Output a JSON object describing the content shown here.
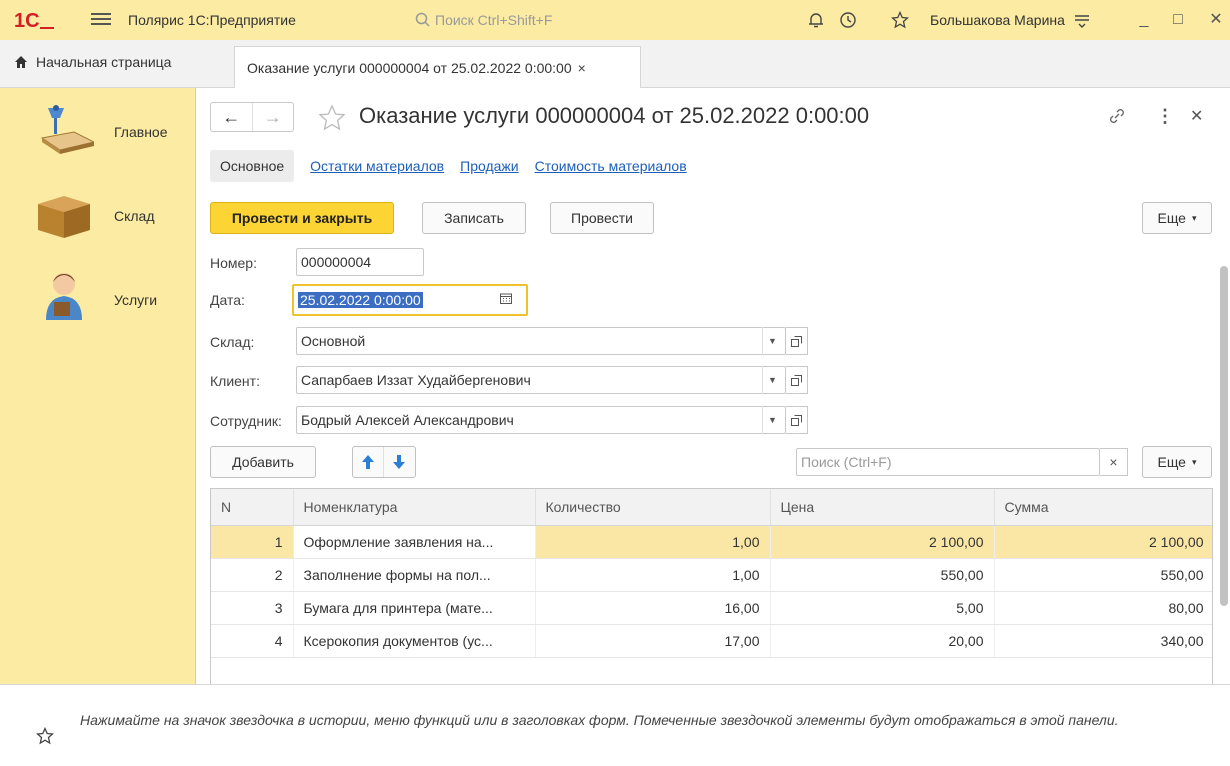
{
  "app": {
    "logo_text": "1С",
    "title": "Полярис 1С:Предприятие",
    "search_placeholder": "Поиск Ctrl+Shift+F",
    "user": "Большакова Марина",
    "brand_color": "#fbeba3"
  },
  "tabs": {
    "home": "Начальная страница",
    "active": "Оказание услуги 000000004 от 25.02.2022 0:00:00",
    "active_close": "×"
  },
  "sidebar": {
    "items": [
      {
        "label": "Главное",
        "icon": "desk-lamp-icon"
      },
      {
        "label": "Склад",
        "icon": "box-icon"
      },
      {
        "label": "Услуги",
        "icon": "operator-icon"
      }
    ]
  },
  "form": {
    "title": "Оказание услуги 000000004 от 25.02.2022 0:00:00",
    "subtabs": [
      "Основное",
      "Остатки материалов",
      "Продажи",
      "Стоимость материалов"
    ],
    "buttons": {
      "post_close": "Провести и закрыть",
      "save": "Записать",
      "post": "Провести",
      "more": "Еще"
    },
    "fields": {
      "number_label": "Номер:",
      "number_value": "000000004",
      "date_label": "Дата:",
      "date_value": "25.02.2022  0:00:00",
      "warehouse_label": "Склад:",
      "warehouse_value": "Основной",
      "client_label": "Клиент:",
      "client_value": "Сапарбаев Иззат Худайбергенович",
      "employee_label": "Сотрудник:",
      "employee_value": "Бодрый Алексей Александрович"
    },
    "table_toolbar": {
      "add": "Добавить",
      "search_placeholder": "Поиск (Ctrl+F)",
      "clear": "×",
      "more": "Еще"
    },
    "table": {
      "columns": [
        "N",
        "Номенклатура",
        "Количество",
        "Цена",
        "Сумма"
      ],
      "rows": [
        {
          "n": "1",
          "item": "Оформление заявления на...",
          "qty": "1,00",
          "price": "2 100,00",
          "sum": "2 100,00"
        },
        {
          "n": "2",
          "item": "Заполнение формы на пол...",
          "qty": "1,00",
          "price": "550,00",
          "sum": "550,00"
        },
        {
          "n": "3",
          "item": "Бумага для принтера (мате...",
          "qty": "16,00",
          "price": "5,00",
          "sum": "80,00"
        },
        {
          "n": "4",
          "item": "Ксерокопия документов (ус...",
          "qty": "17,00",
          "price": "20,00",
          "sum": "340,00"
        }
      ]
    }
  },
  "footer": {
    "hint": "Нажимайте на значок звездочка в истории, меню функций или в заголовках форм. Помеченные звездочкой элементы будут отображаться в этой панели."
  }
}
